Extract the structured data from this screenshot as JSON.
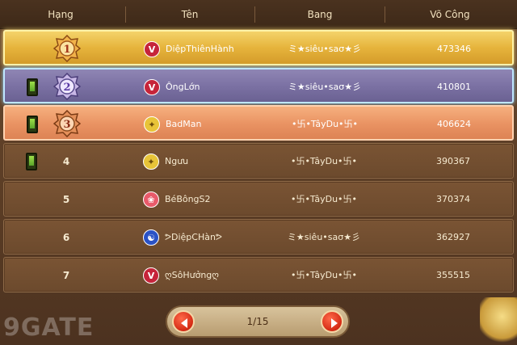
{
  "header": {
    "rank_label": "Hạng",
    "name_label": "Tên",
    "guild_label": "Bang",
    "power_label": "Võ Công"
  },
  "rows": [
    {
      "rank": "1",
      "name": "DiệpThiênHành",
      "guild": "ミ★siêu•saσ★彡",
      "power": "473346",
      "avatar_icon": "class-emblem-icon",
      "has_phone_icon": false
    },
    {
      "rank": "2",
      "name": "ÔngLớn",
      "guild": "ミ★siêu•saσ★彡",
      "power": "410801",
      "avatar_icon": "class-emblem-icon",
      "has_phone_icon": true
    },
    {
      "rank": "3",
      "name": "BadMan",
      "guild": "•卐•TâyDu•卐•",
      "power": "406624",
      "avatar_icon": "class-emblem-icon",
      "has_phone_icon": true
    },
    {
      "rank": "4",
      "name": "Ngưu",
      "guild": "•卐•TâyDu•卐•",
      "power": "390367",
      "avatar_icon": "class-emblem-icon",
      "has_phone_icon": true
    },
    {
      "rank": "5",
      "name": "BéBôngS2",
      "guild": "•卐•TâyDu•卐•",
      "power": "370374",
      "avatar_icon": "class-emblem-icon",
      "has_phone_icon": false
    },
    {
      "rank": "6",
      "name": "ᕗDiệpCHànᕗ",
      "guild": "ミ★siêu•saσ★彡",
      "power": "362927",
      "avatar_icon": "class-emblem-icon",
      "has_phone_icon": false
    },
    {
      "rank": "7",
      "name": "ღSôHưởngღ",
      "guild": "•卐•TâyDu•卐•",
      "power": "355515",
      "avatar_icon": "class-emblem-icon",
      "has_phone_icon": false
    }
  ],
  "pager": {
    "text": "1/15",
    "prev_icon": "arrow-left-icon",
    "next_icon": "arrow-right-icon"
  },
  "watermark": "9GATE",
  "colors": {
    "gold_row": "#e6b43c",
    "silver_row": "#7a70a2",
    "bronze_row": "#e99262",
    "normal_row": "#6c4a2d",
    "pager_button": "#d42a14"
  }
}
